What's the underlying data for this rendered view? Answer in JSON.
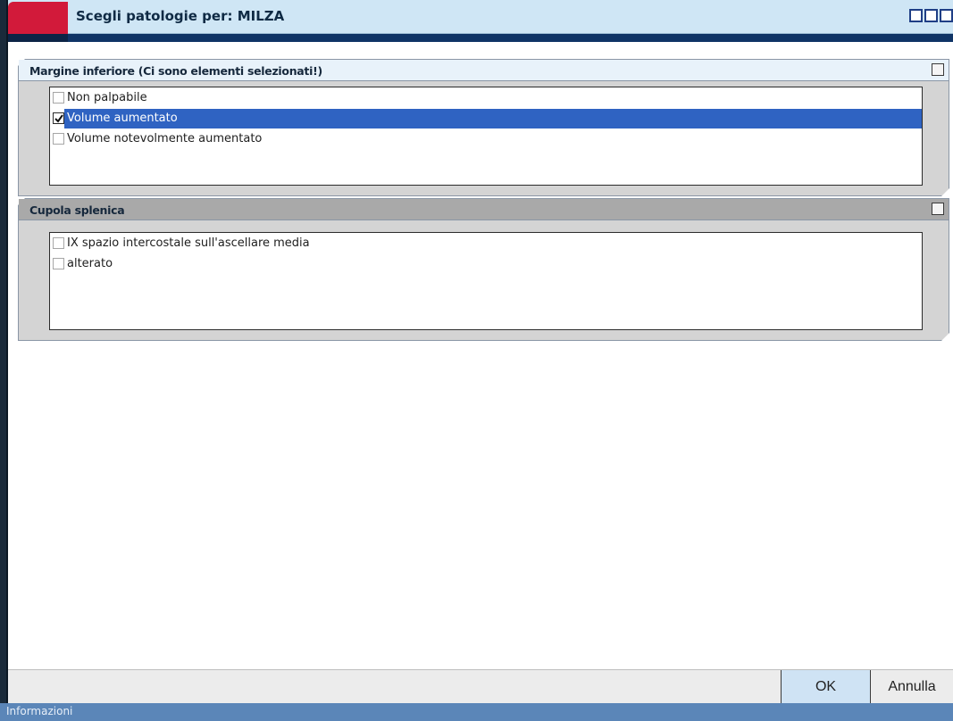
{
  "window": {
    "title": "Scegli patologie per: MILZA"
  },
  "groups": [
    {
      "title": "Margine inferiore (Ci sono elementi selezionati!)",
      "state": "active",
      "items": [
        {
          "label": "Non palpabile",
          "checked": false,
          "selected": false
        },
        {
          "label": "Volume aumentato",
          "checked": true,
          "selected": true
        },
        {
          "label": "Volume notevolmente aumentato",
          "checked": false,
          "selected": false
        }
      ]
    },
    {
      "title": "Cupola splenica",
      "state": "inactive",
      "items": [
        {
          "label": "IX spazio intercostale sull'ascellare media",
          "checked": false,
          "selected": false
        },
        {
          "label": "alterato",
          "checked": false,
          "selected": false
        }
      ]
    }
  ],
  "buttons": {
    "ok_label": "OK",
    "cancel_label": "Annulla"
  },
  "status": {
    "text": "Informazioni"
  },
  "colors": {
    "accent_red": "#d21a3a",
    "selection_blue": "#2f63c2",
    "title_bar": "#cfe6f5",
    "status_bar": "#5b86b8"
  },
  "icons": [
    "window-button-icon",
    "collapse-icon",
    "checkbox-icon",
    "checkmark-icon"
  ]
}
